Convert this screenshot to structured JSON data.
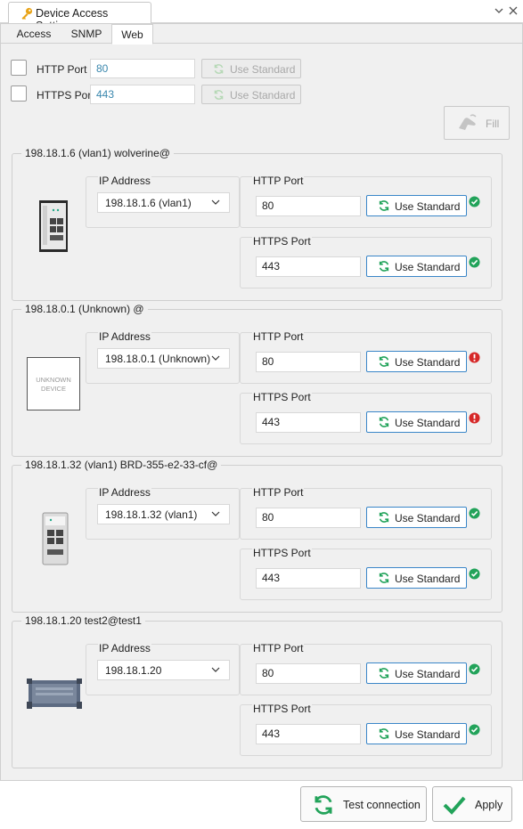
{
  "window": {
    "title": "Device Access Settings",
    "colors": {
      "accent": "#3a86c8",
      "ok": "#22a35a",
      "error": "#d62828",
      "key": "#e8a317"
    }
  },
  "tabs": [
    {
      "label": "Access",
      "active": false
    },
    {
      "label": "SNMP",
      "active": false
    },
    {
      "label": "Web",
      "active": true
    }
  ],
  "global": {
    "http": {
      "label": "HTTP Port",
      "value": "80",
      "button": "Use Standard"
    },
    "https": {
      "label": "HTTPS Port",
      "value": "443",
      "button": "Use Standard"
    },
    "fill_button": "Fill"
  },
  "devices": [
    {
      "title": "198.18.1.6 (vlan1) wolverine@",
      "icon": "switch-dinrail-icon",
      "ip_label": "IP Address",
      "ip_value": "198.18.1.6 (vlan1)",
      "http_label": "HTTP Port",
      "http_value": "80",
      "http_button": "Use Standard",
      "http_status": "ok",
      "https_label": "HTTPS Port",
      "https_value": "443",
      "https_button": "Use Standard",
      "https_status": "ok"
    },
    {
      "title": "198.18.0.1 (Unknown) @",
      "icon": "unknown-device-icon",
      "icon_text": [
        "UNKNOWN",
        "DEVICE"
      ],
      "ip_label": "IP Address",
      "ip_value": "198.18.0.1 (Unknown)",
      "http_label": "HTTP Port",
      "http_value": "80",
      "http_button": "Use Standard",
      "http_status": "error",
      "https_label": "HTTPS Port",
      "https_value": "443",
      "https_button": "Use Standard",
      "https_status": "error"
    },
    {
      "title": "198.18.1.32 (vlan1) BRD-355-e2-33-cf@",
      "icon": "router-dinrail-icon",
      "ip_label": "IP Address",
      "ip_value": "198.18.1.32 (vlan1)",
      "http_label": "HTTP Port",
      "http_value": "80",
      "http_button": "Use Standard",
      "http_status": "ok",
      "https_label": "HTTPS Port",
      "https_value": "443",
      "https_button": "Use Standard",
      "https_status": "ok"
    },
    {
      "title": "198.18.1.20 test2@test1",
      "icon": "rugged-router-icon",
      "ip_label": "IP Address",
      "ip_value": "198.18.1.20",
      "http_label": "HTTP Port",
      "http_value": "80",
      "http_button": "Use Standard",
      "http_status": "ok",
      "https_label": "HTTPS Port",
      "https_value": "443",
      "https_button": "Use Standard",
      "https_status": "ok"
    }
  ],
  "footer": {
    "test_button": "Test connection",
    "apply_button": "Apply"
  }
}
